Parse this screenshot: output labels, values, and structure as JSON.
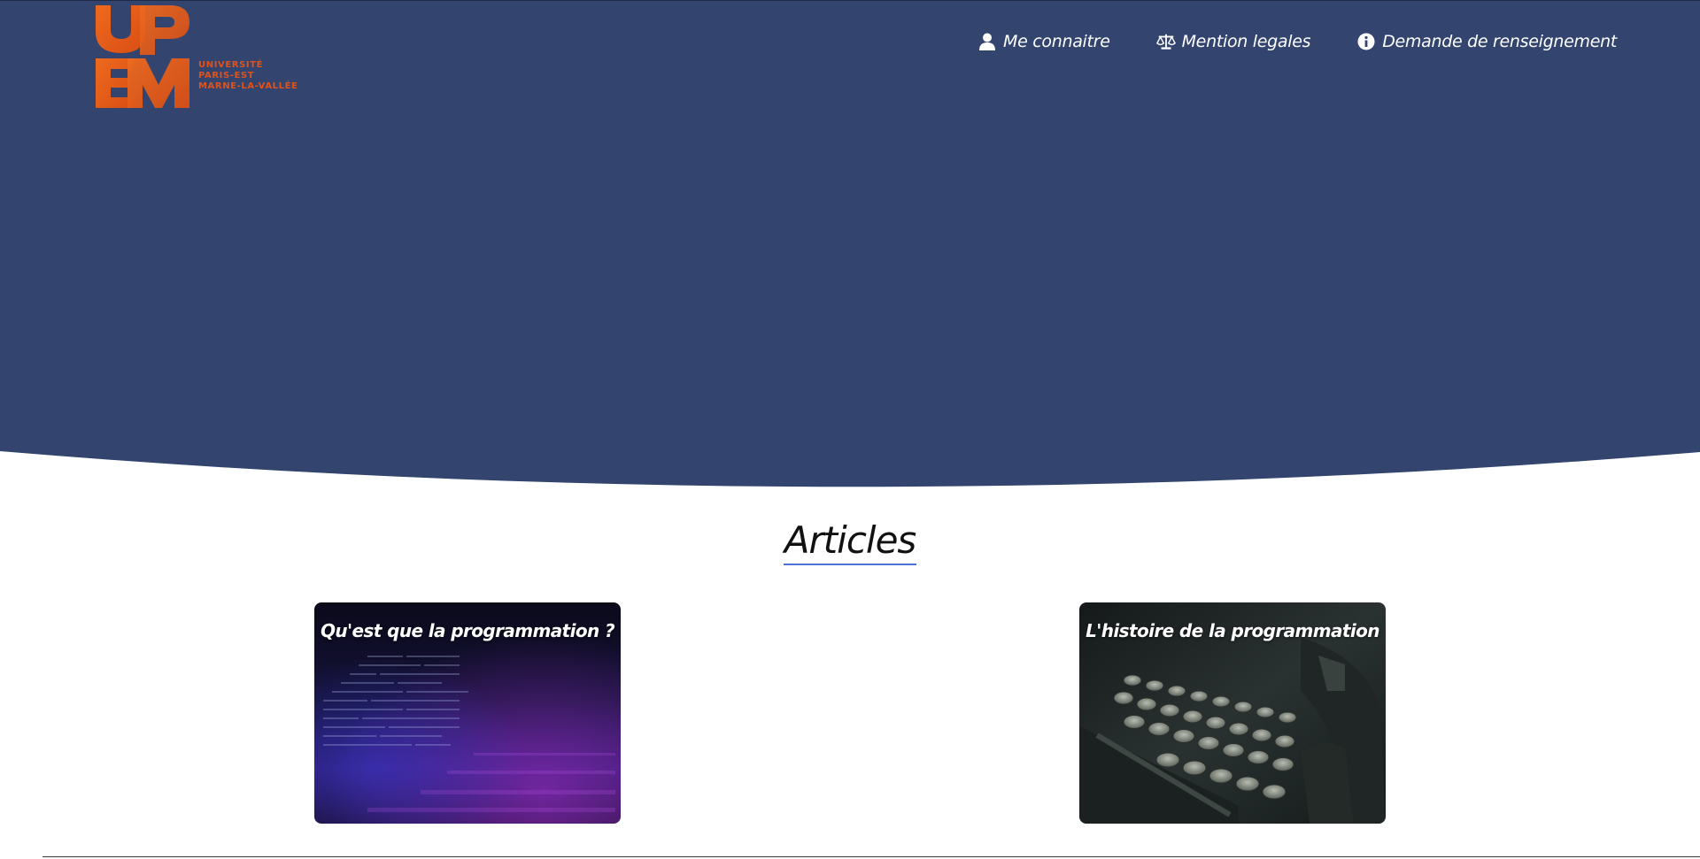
{
  "logo": {
    "letters_top": "UP",
    "letters_bottom": "EM",
    "subtitle_lines": [
      "UNIVERSITÉ",
      "PARIS-EST",
      "MARNE-LA-VALLÉE"
    ],
    "color": "#e0521a"
  },
  "nav": {
    "items": [
      {
        "label": "Me connaitre",
        "icon": "user-icon"
      },
      {
        "label": "Mention legales",
        "icon": "scale-icon"
      },
      {
        "label": "Demande de renseignement",
        "icon": "info-icon"
      }
    ]
  },
  "colors": {
    "hero": "#33456f",
    "accent_underline": "#4a72d8",
    "background": "#ffffff"
  },
  "articles": {
    "title": "Articles",
    "cards": [
      {
        "title": "Qu'est que la programmation ?",
        "image": "code-screen"
      },
      {
        "title": "L'histoire de la programmation",
        "image": "typewriter"
      }
    ]
  }
}
